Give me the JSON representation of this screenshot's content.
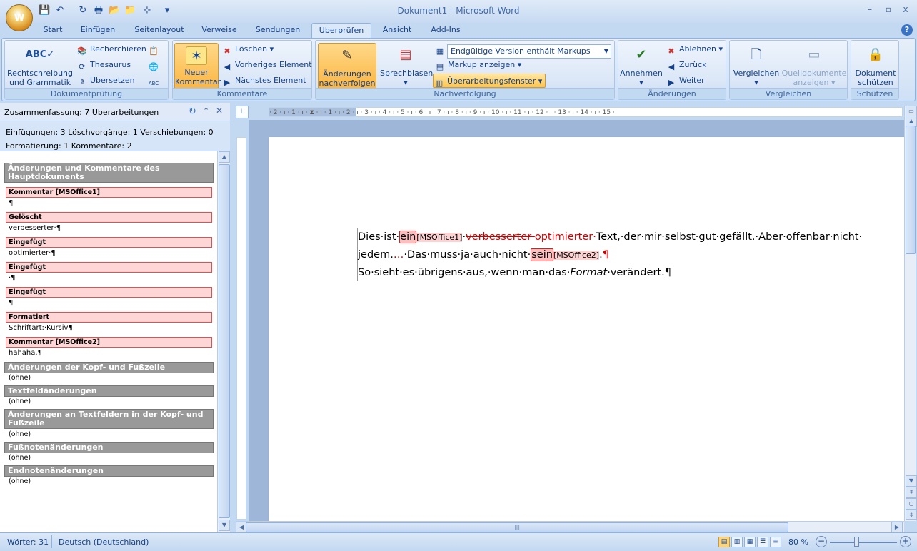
{
  "window": {
    "title": "Dokument1 - Microsoft Word",
    "minimize": "–",
    "restore": "▫",
    "close": "x"
  },
  "office_button": {
    "label": "W"
  },
  "qat": [
    "💾",
    "↶",
    "↻",
    "🖶",
    "📂",
    "📁",
    "⊹",
    "▾"
  ],
  "tabs": [
    {
      "label": "Start"
    },
    {
      "label": "Einfügen"
    },
    {
      "label": "Seitenlayout"
    },
    {
      "label": "Verweise"
    },
    {
      "label": "Sendungen"
    },
    {
      "label": "Überprüfen"
    },
    {
      "label": "Ansicht"
    },
    {
      "label": "Add-Ins"
    }
  ],
  "ribbon": {
    "dokumentpruefung": {
      "label": "Dokumentprüfung",
      "spelling": "Rechtschreibung",
      "spelling2": "und Grammatik",
      "research": "Recherchieren",
      "thesaurus": "Thesaurus",
      "translate": "Übersetzen"
    },
    "kommentare": {
      "label": "Kommentare",
      "new1": "Neuer",
      "new2": "Kommentar",
      "delete": "Löschen",
      "prev": "Vorheriges Element",
      "next": "Nächstes Element"
    },
    "nachverfolgung": {
      "label": "Nachverfolgung",
      "track1": "Änderungen",
      "track2": "nachverfolgen",
      "balloons": "Sprechblasen",
      "markup_select": "Endgültige Version enthält Markups",
      "show_markup": "Markup anzeigen",
      "review_pane": "Überarbeitungsfenster"
    },
    "aenderungen": {
      "label": "Änderungen",
      "accept": "Annehmen",
      "reject": "Ablehnen",
      "back": "Zurück",
      "forward": "Weiter"
    },
    "vergleichen": {
      "label": "Vergleichen",
      "compare": "Vergleichen",
      "source1": "Quelldokumente",
      "source2": "anzeigen"
    },
    "schuetzen": {
      "label": "Schützen",
      "protect1": "Dokument",
      "protect2": "schützen"
    }
  },
  "pane": {
    "title": "Zusammenfassung: 7 Überarbeitungen",
    "stats1": "Einfügungen: 3  Löschvorgänge: 1  Verschiebungen: 0",
    "stats2": "Formatierung: 1  Kommentare: 2",
    "main_section": "Änderungen und Kommentare des Hauptdokuments",
    "items": [
      {
        "head": "Kommentar [MSOffice1]",
        "text": "¶"
      },
      {
        "head": "Gelöscht",
        "text": "verbesserter·¶"
      },
      {
        "head": "Eingefügt",
        "text": "optimierter·¶"
      },
      {
        "head": "Eingefügt",
        "text": "·¶"
      },
      {
        "head": "Eingefügt",
        "text": "¶"
      },
      {
        "head": "Formatiert",
        "text": "Schriftart:·Kursiv¶"
      },
      {
        "head": "Kommentar [MSOffice2]",
        "text": "hahaha.¶"
      }
    ],
    "sections": [
      {
        "title": "Änderungen der Kopf- und Fußzeile",
        "none": "(ohne)"
      },
      {
        "title": "Textfeldänderungen",
        "none": "(ohne)"
      },
      {
        "title": "Änderungen an Textfeldern in der Kopf- und Fußzeile",
        "none": "(ohne)"
      },
      {
        "title": "Fußnotenänderungen",
        "none": "(ohne)"
      },
      {
        "title": "Endnotenänderungen",
        "none": "(ohne)"
      }
    ]
  },
  "ruler": {
    "corner": "L",
    "h": "· 2 · ı · 1 · ı · ⧗ · ı · 1 · ı · 2 · ı · 3 · ı · 4 · ı · 5 · ı · 6 · ı · 7 · ı · 8 · ı · 9 · ı · 10 · ı · 11 · ı · 12 · ı · 13 · ı · 14 · ı · 15 ·"
  },
  "document": {
    "l1a": "Dies·ist·",
    "l1b": "ein",
    "l1c": "[MSOffice1]",
    "l1d": "·",
    "l1e": "verbesserter·",
    "l1f": "optimierter·",
    "l1g": "Text,·der·mir·selbst·gut·gefällt.·Aber·offenbar·nicht·",
    "l2a": "jedem.",
    "l2b": "…",
    "l2c": "·Das·muss·ja·auch·nicht·",
    "l2d": "sein",
    "l2e": "[MSOffice2]",
    "l2f": ".",
    "l2g": "¶",
    "l3a": "So·sieht·es·übrigens·aus,·wenn·man·das·",
    "l3b": "Format",
    "l3c": "·verändert.¶"
  },
  "status": {
    "words": "Wörter: 31",
    "language": "Deutsch (Deutschland)",
    "zoom": "80 %"
  },
  "colors": {
    "change": "#cc0000",
    "accent": "#15428b"
  }
}
